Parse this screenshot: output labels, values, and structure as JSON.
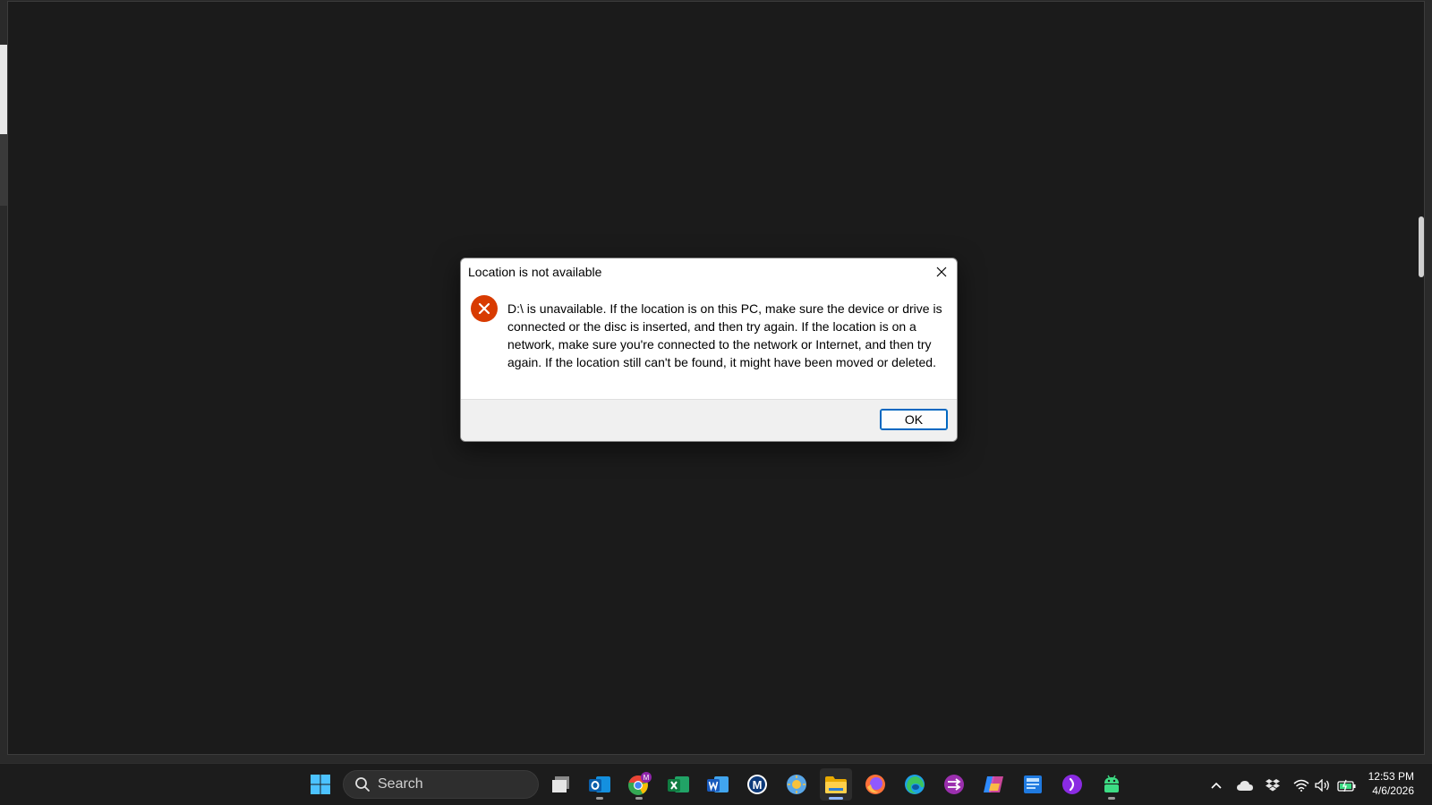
{
  "dialog": {
    "title": "Location is not available",
    "message": "D:\\ is unavailable. If the location is on this PC, make sure the device or drive is connected or the disc is inserted, and then try again. If the location is on a network, make sure you're connected to the network or Internet, and then try again. If the location still can't be found, it might have been moved or deleted.",
    "ok_label": "OK",
    "close_icon": "close-icon",
    "error_icon": "error-icon",
    "error_color": "#d83b01"
  },
  "taskbar": {
    "search_label": "Search",
    "apps": [
      {
        "name": "start-button",
        "icon": "windows-logo-icon"
      },
      {
        "name": "task-view",
        "icon": "task-view-icon"
      },
      {
        "name": "outlook",
        "icon": "outlook-icon"
      },
      {
        "name": "chrome",
        "icon": "chrome-icon",
        "badge": "M"
      },
      {
        "name": "excel",
        "icon": "excel-icon"
      },
      {
        "name": "word",
        "icon": "word-icon"
      },
      {
        "name": "malwarebytes",
        "icon": "malwarebytes-icon"
      },
      {
        "name": "app-sun",
        "icon": "sun-app-icon"
      },
      {
        "name": "file-explorer",
        "icon": "folder-icon"
      },
      {
        "name": "firefox",
        "icon": "firefox-icon"
      },
      {
        "name": "edge",
        "icon": "edge-icon"
      },
      {
        "name": "power-automate",
        "icon": "power-automate-icon"
      },
      {
        "name": "copilot",
        "icon": "copilot-icon"
      },
      {
        "name": "store-app",
        "icon": "store-app-icon"
      },
      {
        "name": "media-app",
        "icon": "media-app-icon"
      },
      {
        "name": "android-app",
        "icon": "android-icon"
      }
    ],
    "tray": {
      "chevron": "chevron-up-icon",
      "cloud": "onedrive-icon",
      "dropbox": "dropbox-icon",
      "wifi": "wifi-icon",
      "volume": "volume-icon",
      "battery": "battery-charging-icon"
    },
    "time": "12:53 PM",
    "date": "4/6/2026"
  }
}
